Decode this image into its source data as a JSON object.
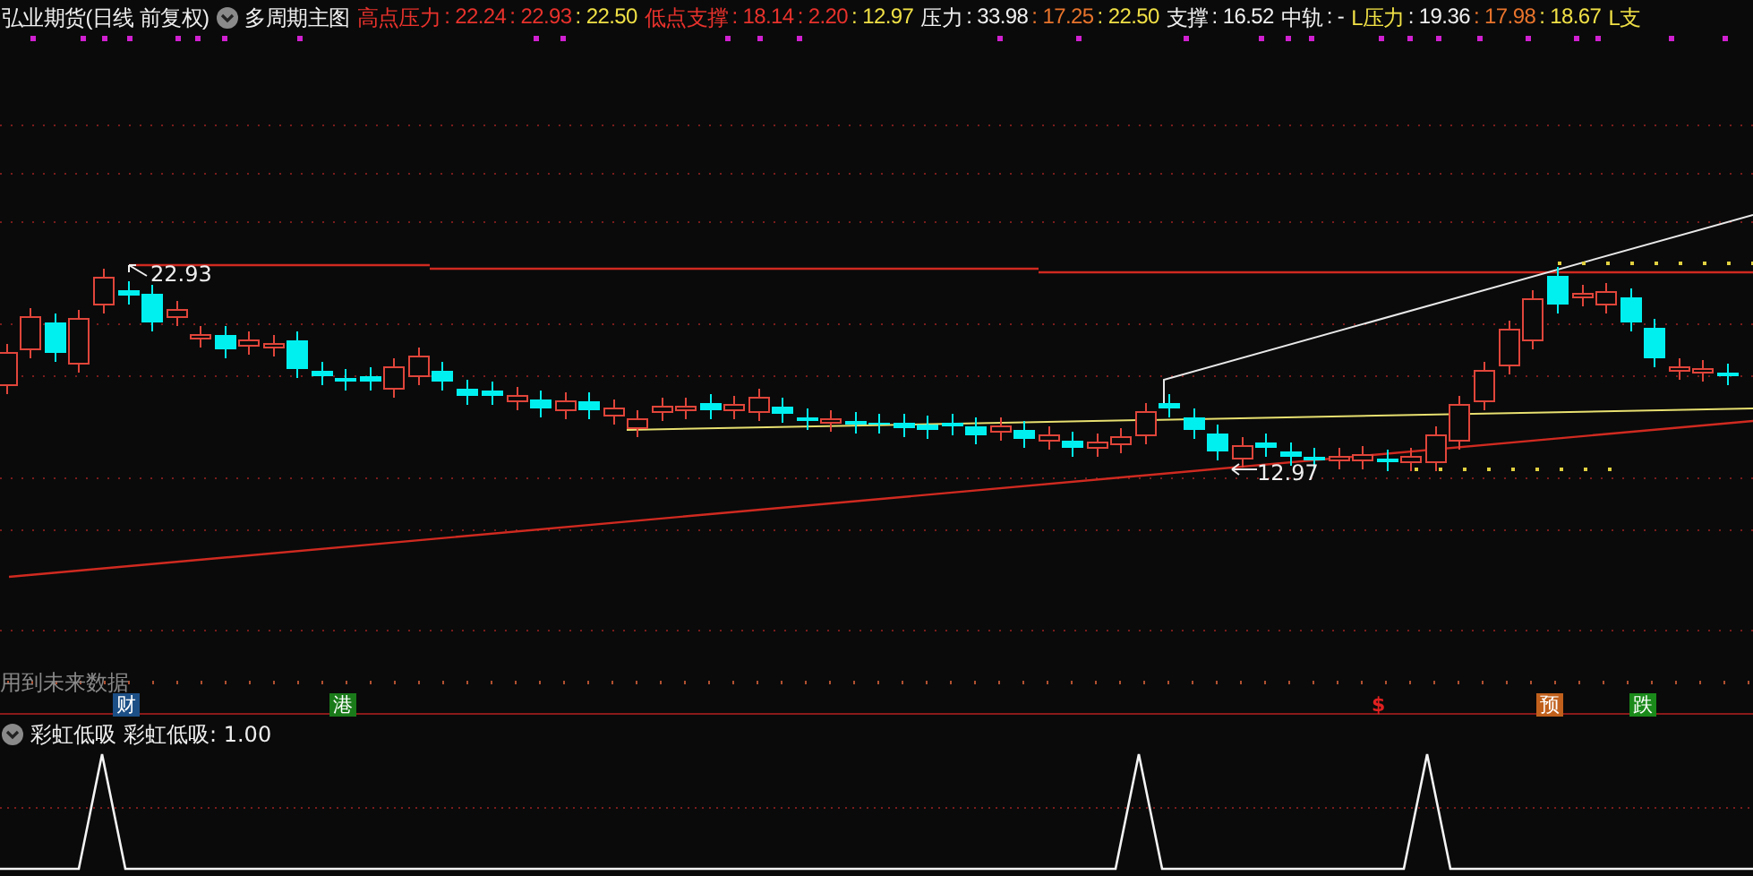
{
  "header": {
    "title": "弘业期货(日线 前复权)",
    "indicator": "多周期主图",
    "fields": [
      {
        "label": "高点压力",
        "color": "#e8322c",
        "values": [
          {
            "text": ": 22.24",
            "color": "#e8322c"
          },
          {
            "text": ": 22.93",
            "color": "#e8322c"
          },
          {
            "text": ": 22.50",
            "color": "#f0e046"
          }
        ]
      },
      {
        "label": "低点支撑",
        "color": "#e8322c",
        "values": [
          {
            "text": ": 18.14",
            "color": "#e8322c"
          },
          {
            "text": ": 2.20",
            "color": "#e8322c"
          },
          {
            "text": ": 12.97",
            "color": "#f0e046"
          }
        ]
      },
      {
        "label": "压力",
        "color": "#f0f0f0",
        "values": [
          {
            "text": ": 33.98",
            "color": "#f0f0f0"
          },
          {
            "text": ": 17.25",
            "color": "#e8742c"
          },
          {
            "text": ": 22.50",
            "color": "#f0e046"
          }
        ]
      },
      {
        "label": "支撑",
        "color": "#f0f0f0",
        "values": [
          {
            "text": ": 16.52",
            "color": "#f0f0f0"
          }
        ]
      },
      {
        "label": "中轨",
        "color": "#f0f0f0",
        "values": [
          {
            "text": ": -",
            "color": "#f0f0f0"
          }
        ]
      },
      {
        "label": "L压力",
        "color": "#f0e046",
        "values": [
          {
            "text": ": 19.36",
            "color": "#f0f0f0"
          },
          {
            "text": ": 17.98",
            "color": "#e8742c"
          },
          {
            "text": ": 18.67",
            "color": "#f0e046"
          }
        ]
      },
      {
        "label": "L支",
        "color": "#f0e046"
      }
    ]
  },
  "chart": {
    "annotations": [
      {
        "text": "22.93"
      },
      {
        "text": "12.97"
      }
    ],
    "note": "用到未来数据",
    "signals": [
      {
        "kind": "badge",
        "text": "财",
        "color": "#1c4f86"
      },
      {
        "kind": "badge",
        "text": "港",
        "color": "#1a7a1a"
      },
      {
        "kind": "symbol",
        "text": "$",
        "color": "#e02020"
      },
      {
        "kind": "badge",
        "text": "预",
        "color": "#c0601c"
      },
      {
        "kind": "badge",
        "text": "跌",
        "color": "#1a8a1a"
      }
    ]
  },
  "sub_panel": {
    "title": "彩虹低吸",
    "reading": "彩虹低吸: 1.00"
  }
}
